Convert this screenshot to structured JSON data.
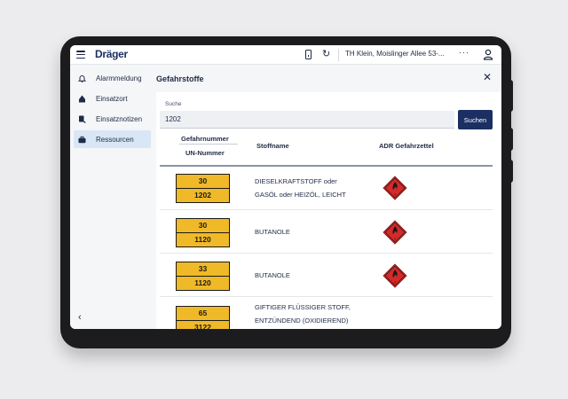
{
  "topbar": {
    "brand": "Dräger",
    "location": "TH Klein, Moislinger Allee 53-...",
    "more_label": "···"
  },
  "icons": {
    "menu": "menu-icon",
    "phone": "phone-icon",
    "refresh": "refresh-icon",
    "more": "more-icon",
    "user": "user-icon",
    "close": "close-icon",
    "back": "chevron-left-icon",
    "hazard": "flammable-hazard-diamond-icon"
  },
  "sidebar": {
    "items": [
      {
        "label": "Alarmmeldung",
        "icon": "bell-icon",
        "active": false
      },
      {
        "label": "Einsatzort",
        "icon": "location-icon",
        "active": false
      },
      {
        "label": "Einsatznotizen",
        "icon": "notes-icon",
        "active": false
      },
      {
        "label": "Ressourcen",
        "icon": "briefcase-icon",
        "active": true
      }
    ]
  },
  "page": {
    "title": "Gefahrstoffe"
  },
  "search": {
    "label": "Suche",
    "value": "1202",
    "button": "Suchen"
  },
  "table": {
    "headers": {
      "hazard_number": "Gefahrnummer",
      "un_number": "UN-Nummer",
      "name": "Stoffname",
      "adr": "ADR Gefahrzettel"
    },
    "rows": [
      {
        "hazard": "30",
        "un": "1202",
        "name_line1": "DIESELKRAFTSTOFF oder",
        "name_line2": "GASÖL oder HEIZÖL, LEICHT"
      },
      {
        "hazard": "30",
        "un": "1120",
        "name_line1": "BUTANOLE",
        "name_line2": ""
      },
      {
        "hazard": "33",
        "un": "1120",
        "name_line1": "BUTANOLE",
        "name_line2": ""
      },
      {
        "hazard": "65",
        "un": "3122",
        "name_line1": "GIFTIGER FLÜSSIGER STOFF,",
        "name_line2": "ENTZÜNDEND (OXIDIEREND)"
      }
    ]
  },
  "colors": {
    "brand": "#1b2f63",
    "plate": "#f0b927",
    "hazard_red": "#d42a2a",
    "active_nav": "#d9e6f6"
  }
}
